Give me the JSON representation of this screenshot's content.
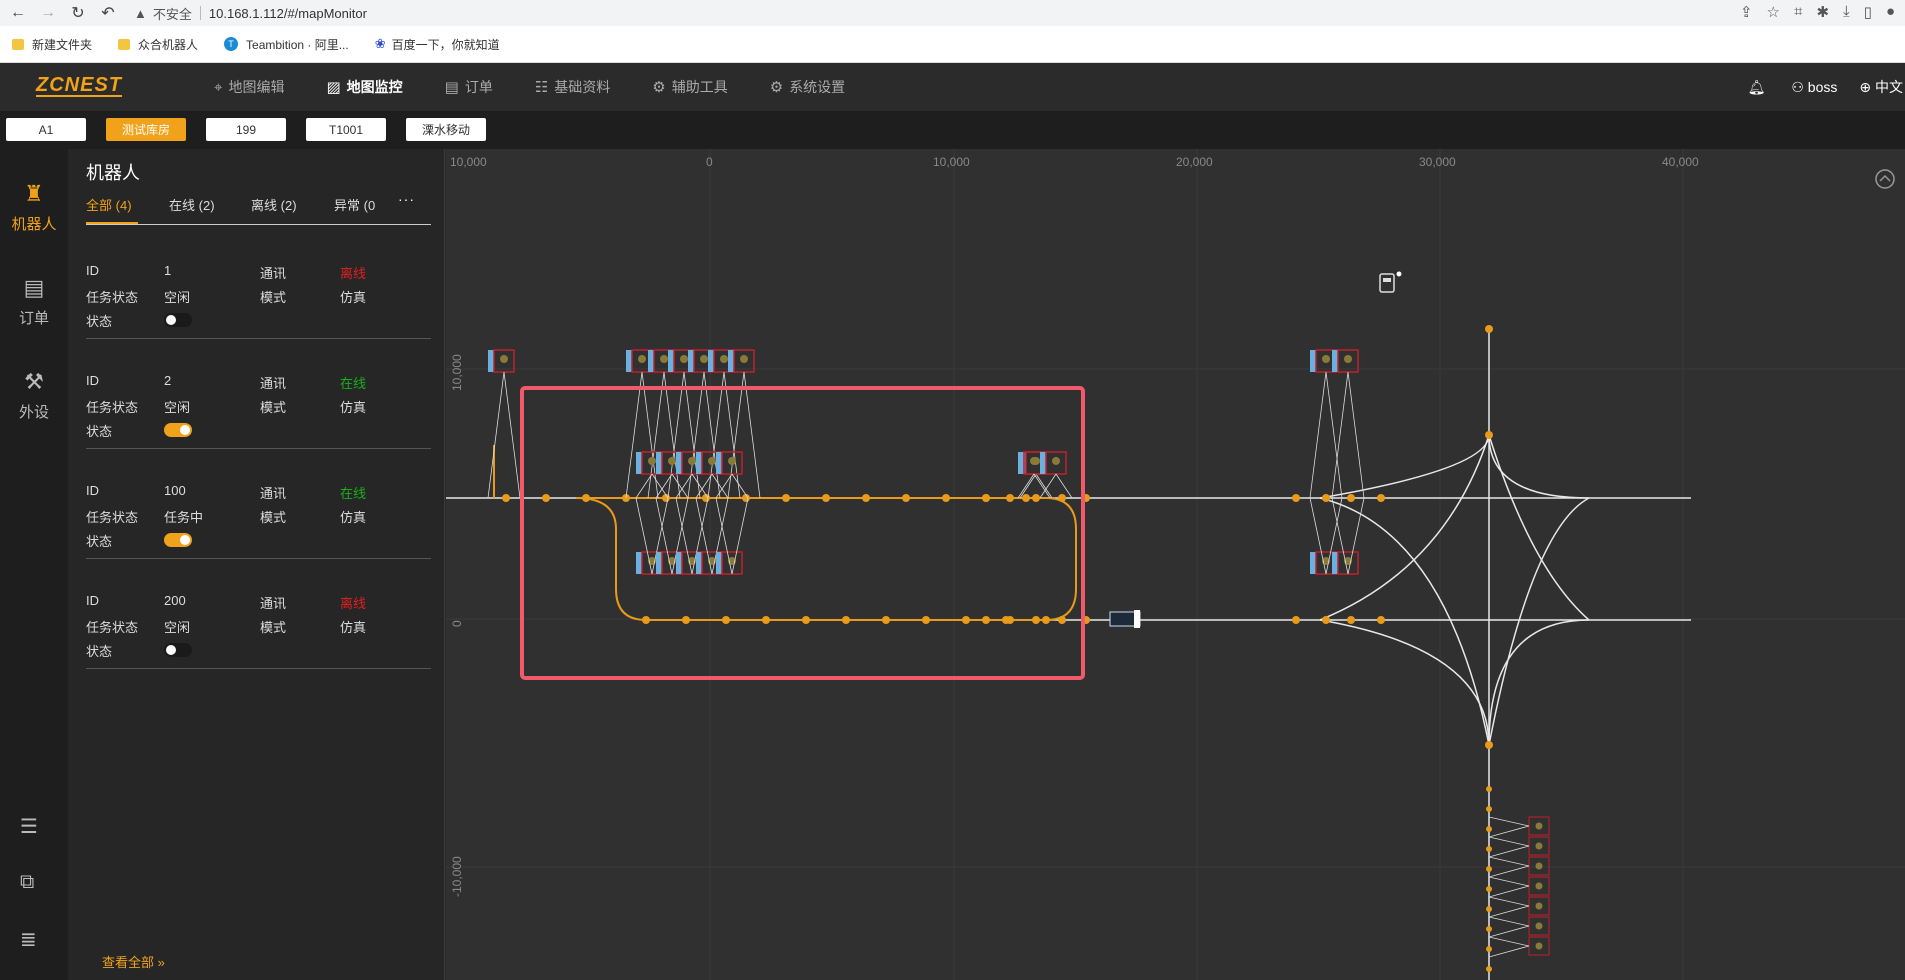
{
  "browser": {
    "address_warning": "不安全",
    "url": "10.168.1.112/#/mapMonitor",
    "bookmarks": [
      {
        "label": "新建文件夹",
        "icon": "folder-icon"
      },
      {
        "label": "众合机器人",
        "icon": "folder-icon"
      },
      {
        "label": "Teambition · 阿里...",
        "icon": "teambition-icon"
      },
      {
        "label": "百度一下，你就知道",
        "icon": "baidu-paw-icon"
      }
    ]
  },
  "header": {
    "logo": "ZCNEST",
    "nav": [
      {
        "label": "地图编辑",
        "icon": "map-pin-icon",
        "active": false
      },
      {
        "label": "地图监控",
        "icon": "chart-icon",
        "active": true
      },
      {
        "label": "订单",
        "icon": "document-icon",
        "active": false
      },
      {
        "label": "基础资料",
        "icon": "sliders-icon",
        "active": false
      },
      {
        "label": "辅助工具",
        "icon": "gear-icon",
        "active": false
      },
      {
        "label": "系统设置",
        "icon": "gear-icon",
        "active": false
      }
    ],
    "user": "boss",
    "language": "中文"
  },
  "filters": [
    "A1",
    "测试库房",
    "199",
    "T1001",
    "溧水移动"
  ],
  "rail": {
    "items": [
      {
        "label": "机器人",
        "icon": "robot-icon",
        "active": true
      },
      {
        "label": "订单",
        "icon": "document-icon",
        "active": false
      },
      {
        "label": "外设",
        "icon": "wrench-icon",
        "active": false
      }
    ]
  },
  "panel": {
    "title": "机器人",
    "tabs": [
      {
        "label": "全部",
        "count": "(4)",
        "active": true
      },
      {
        "label": "在线",
        "count": "(2)",
        "active": false
      },
      {
        "label": "离线",
        "count": "(2)",
        "active": false
      },
      {
        "label": "异常",
        "count": "(0",
        "active": false
      }
    ],
    "labels": {
      "id": "ID",
      "comm": "通讯",
      "task": "任务状态",
      "mode": "模式",
      "state": "状态"
    },
    "robots": [
      {
        "id": "1",
        "comm": "离线",
        "task": "空闲",
        "mode": "仿真",
        "enabled": false
      },
      {
        "id": "2",
        "comm": "在线",
        "task": "空闲",
        "mode": "仿真",
        "enabled": true
      },
      {
        "id": "100",
        "comm": "在线",
        "task": "任务中",
        "mode": "仿真",
        "enabled": true
      },
      {
        "id": "200",
        "comm": "离线",
        "task": "空闲",
        "mode": "仿真",
        "enabled": false
      }
    ],
    "view_all": "查看全部"
  },
  "map": {
    "x_ticks": [
      "10,000",
      "0",
      "10,000",
      "20,000",
      "30,000",
      "40,000"
    ],
    "y_ticks": [
      "10,000",
      "0",
      "-10,000"
    ],
    "accent": "#f0a21a",
    "highlight": "#f05a6a"
  }
}
